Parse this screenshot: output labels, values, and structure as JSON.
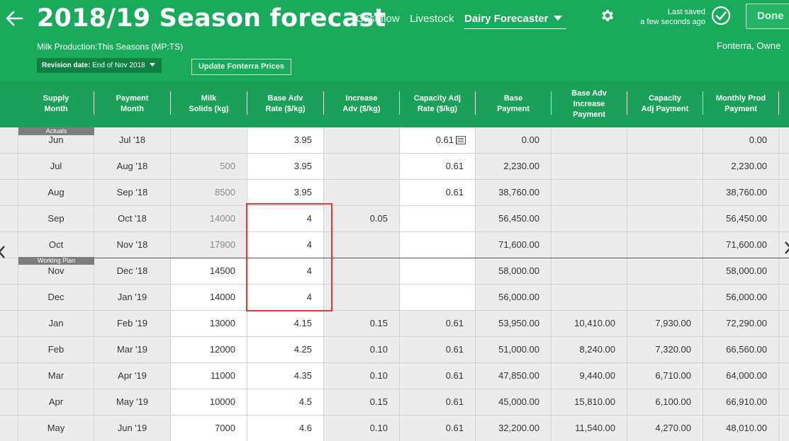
{
  "header": {
    "title": "2018/19 Season forecast",
    "nav": {
      "cashflow": "Cashflow",
      "livestock": "Livestock",
      "dairy_forecaster": "Dairy Forecaster"
    },
    "saved_line1": "Last saved",
    "saved_line2": "a few seconds ago",
    "done_label": "Done",
    "subtitle": "Milk Production:This Seasons (MP:TS)",
    "company": "Fonterra, Owne",
    "revision_label": "Revision date:",
    "revision_value": "End of Nov 2018",
    "update_prices_label": "Update Fonterra Prices",
    "accent_color": "#1aaa5c"
  },
  "columns": [
    {
      "line1": "Supply",
      "line2": "Month"
    },
    {
      "line1": "Payment",
      "line2": "Month"
    },
    {
      "line1": "Milk",
      "line2": "Solids (kg)"
    },
    {
      "line1": "Base Adv",
      "line2": "Rate ($/kg)"
    },
    {
      "line1": "Increase",
      "line2": "Adv ($/kg)"
    },
    {
      "line1": "Capacity Adj",
      "line2": "Rate ($/kg)"
    },
    {
      "line1": "Base",
      "line2": "Payment"
    },
    {
      "line1": "Base Adv",
      "line2": "Increase",
      "line3": "Payment"
    },
    {
      "line1": "Capacity",
      "line2": "Adj Payment"
    },
    {
      "line1": "Monthly Prod",
      "line2": "Payment"
    }
  ],
  "section_tags": {
    "actuals": "Actuals",
    "working_plan": "Working Plan"
  },
  "rows": [
    {
      "supply": "Jun",
      "payment": "Jul '18",
      "solids": "",
      "base_rate": "3.95",
      "increase": "",
      "cap_rate": "0.61",
      "base_pay": "0.00",
      "inc_pay": "",
      "cap_pay": "",
      "monthly": "0.00"
    },
    {
      "supply": "Jul",
      "payment": "Aug '18",
      "solids": "500",
      "base_rate": "3.95",
      "increase": "",
      "cap_rate": "0.61",
      "base_pay": "2,230.00",
      "inc_pay": "",
      "cap_pay": "",
      "monthly": "2,230.00"
    },
    {
      "supply": "Aug",
      "payment": "Sep '18",
      "solids": "8500",
      "base_rate": "3.95",
      "increase": "",
      "cap_rate": "0.61",
      "base_pay": "38,760.00",
      "inc_pay": "",
      "cap_pay": "",
      "monthly": "38,760.00"
    },
    {
      "supply": "Sep",
      "payment": "Oct '18",
      "solids": "14000",
      "base_rate": "4",
      "increase": "0.05",
      "cap_rate": "",
      "base_pay": "56,450.00",
      "inc_pay": "",
      "cap_pay": "",
      "monthly": "56,450.00"
    },
    {
      "supply": "Oct",
      "payment": "Nov '18",
      "solids": "17900",
      "base_rate": "4",
      "increase": "",
      "cap_rate": "",
      "base_pay": "71,600.00",
      "inc_pay": "",
      "cap_pay": "",
      "monthly": "71,600.00"
    },
    {
      "supply": "Nov",
      "payment": "Dec '18",
      "solids": "14500",
      "base_rate": "4",
      "increase": "",
      "cap_rate": "",
      "base_pay": "58,000.00",
      "inc_pay": "",
      "cap_pay": "",
      "monthly": "58,000.00"
    },
    {
      "supply": "Dec",
      "payment": "Jan '19",
      "solids": "14000",
      "base_rate": "4",
      "increase": "",
      "cap_rate": "",
      "base_pay": "56,000.00",
      "inc_pay": "",
      "cap_pay": "",
      "monthly": "56,000.00"
    },
    {
      "supply": "Jan",
      "payment": "Feb '19",
      "solids": "13000",
      "base_rate": "4.15",
      "increase": "0.15",
      "cap_rate": "0.61",
      "base_pay": "53,950.00",
      "inc_pay": "10,410.00",
      "cap_pay": "7,930.00",
      "monthly": "72,290.00"
    },
    {
      "supply": "Feb",
      "payment": "Mar '19",
      "solids": "12000",
      "base_rate": "4.25",
      "increase": "0.10",
      "cap_rate": "0.61",
      "base_pay": "51,000.00",
      "inc_pay": "8,240.00",
      "cap_pay": "7,320.00",
      "monthly": "66,560.00"
    },
    {
      "supply": "Mar",
      "payment": "Apr '19",
      "solids": "11000",
      "base_rate": "4.35",
      "increase": "0.10",
      "cap_rate": "0.61",
      "base_pay": "47,850.00",
      "inc_pay": "9,440.00",
      "cap_pay": "6,710.00",
      "monthly": "64,000.00"
    },
    {
      "supply": "Apr",
      "payment": "May '19",
      "solids": "10000",
      "base_rate": "4.5",
      "increase": "0.15",
      "cap_rate": "0.61",
      "base_pay": "45,000.00",
      "inc_pay": "15,810.00",
      "cap_pay": "6,100.00",
      "monthly": "66,910.00"
    },
    {
      "supply": "May",
      "payment": "Jun '19",
      "solids": "7000",
      "base_rate": "4.6",
      "increase": "0.10",
      "cap_rate": "0.61",
      "base_pay": "32,200.00",
      "inc_pay": "11,540.00",
      "cap_pay": "4,270.00",
      "monthly": "48,010.00"
    }
  ]
}
